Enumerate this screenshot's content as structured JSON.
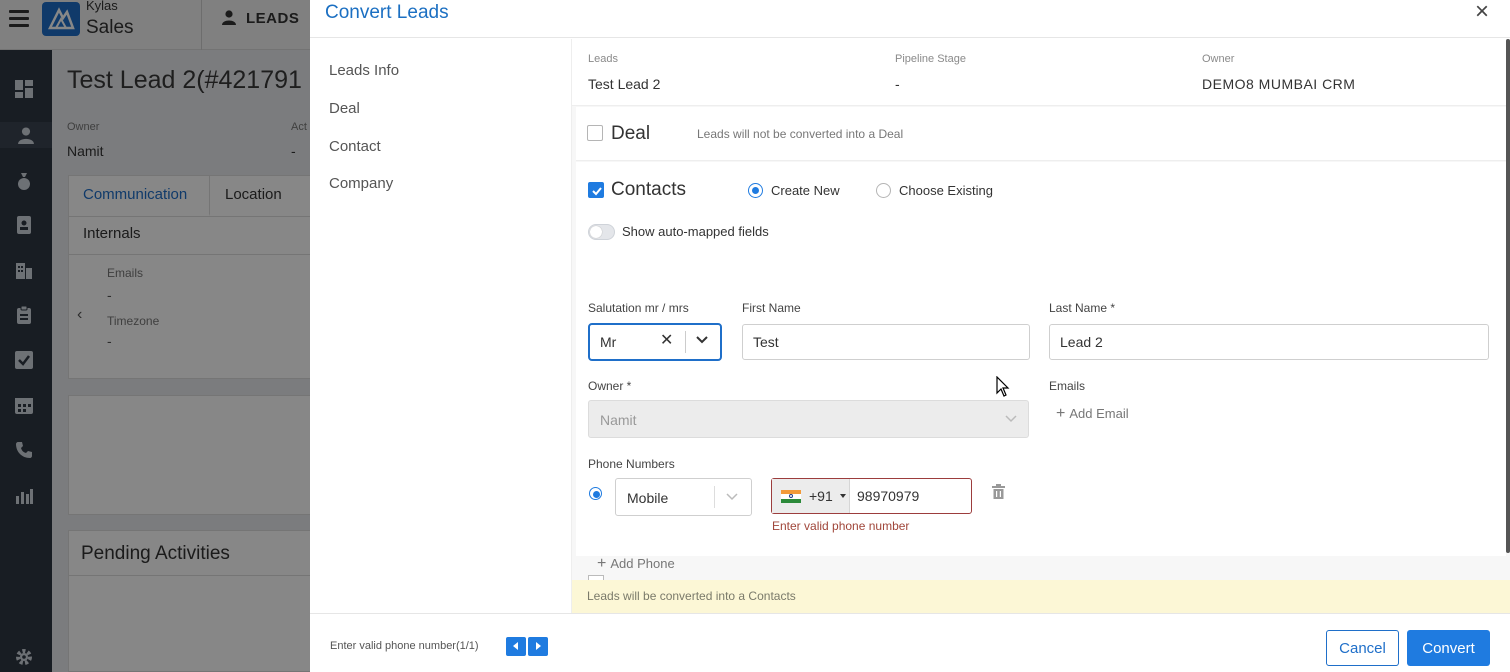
{
  "app": {
    "brand_top": "Kylas",
    "brand": "Sales",
    "module": "LEADS"
  },
  "background": {
    "title": "Test Lead 2(#421791",
    "owner_label": "Owner",
    "owner_value": "Namit",
    "act_label": "Act",
    "act_value": "-",
    "tabs": [
      "Communication",
      "Location",
      "Internals"
    ],
    "emails_label": "Emails",
    "emails_value": "-",
    "timezone_label": "Timezone",
    "timezone_value": "-",
    "pending_title": "Pending Activities"
  },
  "modal": {
    "title": "Convert Leads",
    "close": "×",
    "nav": [
      "Leads Info",
      "Deal",
      "Contact",
      "Company"
    ],
    "info": {
      "leads_label": "Leads",
      "leads_value": "Test Lead 2",
      "stage_label": "Pipeline Stage",
      "stage_value": "-",
      "owner_label": "Owner",
      "owner_value": "DEMO8 MUMBAI CRM"
    },
    "deal": {
      "label": "Deal",
      "checked": false,
      "note": "Leads will not be converted into a Deal"
    },
    "contacts": {
      "label": "Contacts",
      "checked": true,
      "create_new": "Create New",
      "choose_existing": "Choose Existing",
      "toggle_label": "Show auto-mapped fields",
      "salutation_label": "Salutation mr / mrs",
      "salutation_value": "Mr",
      "first_name_label": "First Name",
      "first_name_value": "Test",
      "last_name_label": "Last Name *",
      "last_name_value": "Lead 2",
      "owner_label": "Owner *",
      "owner_value": "Namit",
      "emails_label": "Emails",
      "add_email": "Add Email",
      "phone_label": "Phone Numbers",
      "phone_type": "Mobile",
      "country_code": "+91",
      "phone_value": "98970979",
      "phone_error": "Enter valid phone number",
      "add_phone": "Add Phone"
    },
    "yellow_note": "Leads will be converted into a Contacts",
    "footer": {
      "error": "Enter valid phone number(1/1)",
      "cancel": "Cancel",
      "convert": "Convert"
    }
  },
  "colors": {
    "accent": "#1f7be0",
    "title_blue": "#1b6fc2",
    "error": "#a0463a",
    "note_bg": "#fcf7d6"
  }
}
